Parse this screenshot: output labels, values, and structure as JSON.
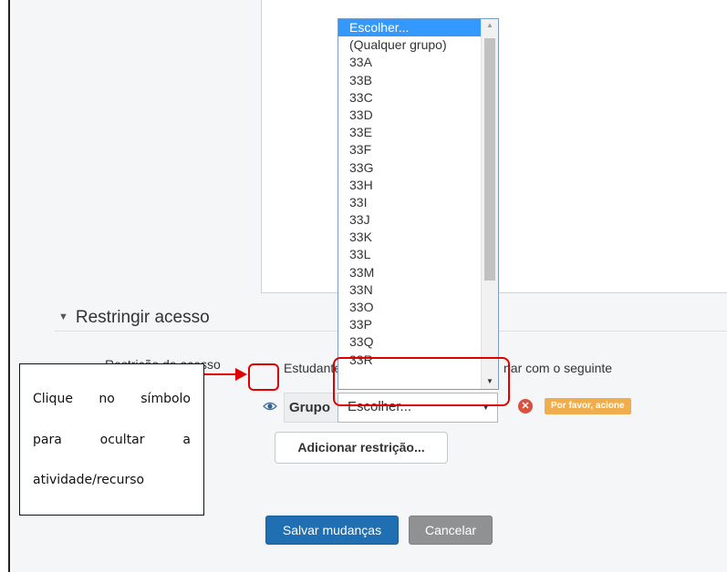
{
  "section": {
    "title": "Restringir acesso"
  },
  "access": {
    "label": "Restrição de acesso",
    "text_left": "Estudante",
    "text_right": "nar com o seguinte"
  },
  "condition": {
    "type_label": "Grupo",
    "selected": "Escolher...",
    "warning_badge": "Por favor, acione"
  },
  "dropdown": {
    "options": [
      "Escolher...",
      "(Qualquer grupo)",
      "33A",
      "33B",
      "33C",
      "33D",
      "33E",
      "33F",
      "33G",
      "33H",
      "33I",
      "33J",
      "33K",
      "33L",
      "33M",
      "33N",
      "33O",
      "33P",
      "33Q",
      "33R"
    ],
    "highlighted_index": 0
  },
  "buttons": {
    "add_restriction": "Adicionar restrição...",
    "save": "Salvar mudanças",
    "cancel": "Cancelar"
  },
  "callout": {
    "line1": [
      "Clique",
      "no",
      "símbolo"
    ],
    "line2": [
      "para",
      "ocultar",
      "a"
    ],
    "line3": "atividade/recurso"
  },
  "colors": {
    "primary": "#1f6fb2",
    "annotation": "#e00000",
    "warning": "#f0ad4e",
    "danger": "#d9503f"
  },
  "icons": [
    "eye-icon",
    "error-icon",
    "caret-down-icon",
    "dropdown-arrow-icon"
  ]
}
